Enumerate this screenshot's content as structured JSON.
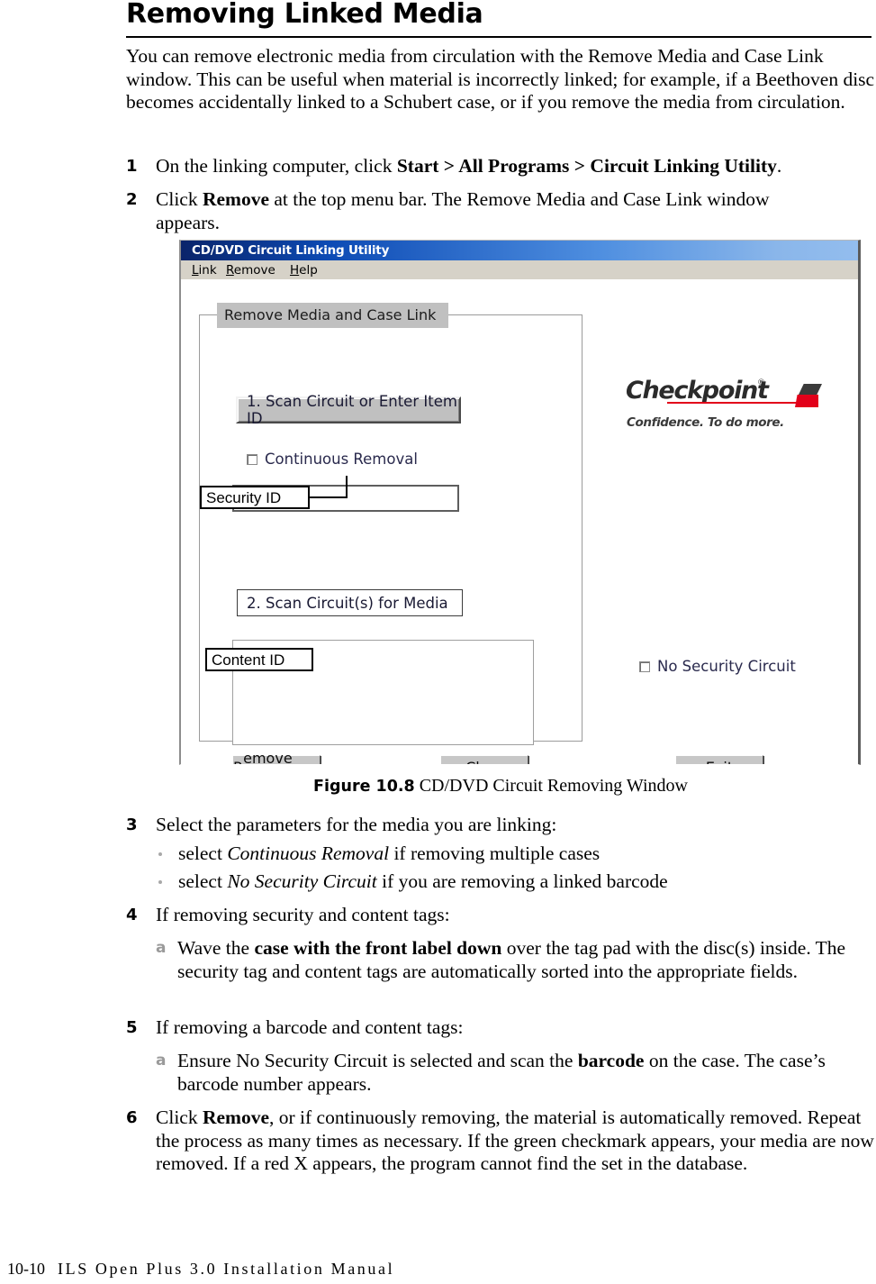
{
  "page": {
    "title": "Removing Linked Media",
    "intro": "You can remove electronic media from circulation with the Remove Media and Case Link window. This can be useful when material is incorrectly linked; for example, if a Beethoven disc becomes accidentally linked to a Schubert case, or if you remove the media from circulation."
  },
  "steps": {
    "s1": {
      "num": "1",
      "lead": "On the linking computer, click ",
      "bold": "Start > All Programs > Circuit Linking Utility",
      "tail": "."
    },
    "s2": {
      "num": "2",
      "lead": "Click ",
      "bold": "Remove",
      "tail": " at the top menu bar. The Remove Media and Case Link window appears."
    },
    "s3": {
      "num": "3",
      "text": "Select the parameters for the media you are linking:"
    },
    "b1": {
      "lead": "select ",
      "italic": "Continuous Removal",
      "tail": " if removing multiple cases"
    },
    "b2": {
      "lead": "select ",
      "italic": "No Security Circuit",
      "tail": " if you are removing a linked barcode"
    },
    "s4": {
      "num": "4",
      "text": "If removing security and content tags:"
    },
    "s4a": {
      "letter": "a",
      "lead": "Wave the ",
      "bold": "case with the front label down",
      "tail": " over the tag pad with the disc(s) inside. The security tag and content tags are automatically sorted into the appropriate fields."
    },
    "s5": {
      "num": "5",
      "text": "If removing a barcode and content tags:"
    },
    "s5a": {
      "letter": "a",
      "lead": "Ensure No Security Circuit is selected and scan the ",
      "bold": "barcode",
      "tail": " on the case. The case’s barcode number appears."
    },
    "s6": {
      "num": "6",
      "lead": "Click ",
      "bold": "Remove",
      "tail": ", or if continuously removing, the material is automatically removed. Repeat the process as many times as necessary. If the green checkmark appears, your media are now removed. If a red X appears, the program cannot find the set in the database."
    }
  },
  "figure": {
    "label": "Figure 10.8",
    "caption": " CD/DVD Circuit Removing Window"
  },
  "app": {
    "title": "CD/DVD Circuit Linking Utility",
    "menu": {
      "link": "Link",
      "link_mnemonic": "L",
      "link_rest": "ink",
      "remove": "Remove",
      "remove_mnemonic": "R",
      "remove_rest": "emove",
      "help": "Help",
      "help_mnemonic": "H",
      "help_rest": "elp"
    },
    "group_legend": "Remove Media and Case Link",
    "banner1": "1. Scan Circuit or Enter Item ID",
    "banner2": "2. Scan Circuit(s) for Media",
    "checkbox_continuous": "Continuous Removal",
    "checkbox_nosecurity": "No Security Circuit",
    "field_security_value": "",
    "field_content_value": "",
    "buttons": {
      "remove_link_mnemonic": "R",
      "remove_link_rest": "emove Link",
      "clear_mnemonic": "C",
      "clear_rest": "lear",
      "exit_pre": "E",
      "exit_mnemonic": "x",
      "exit_rest": "it"
    },
    "logo": {
      "word": "Checkpoint",
      "registered": "®",
      "tagline": "Confidence. To do more."
    },
    "colors": {
      "titlebar_dark": "#0a246a",
      "titlebar_light": "#93bdee",
      "menubar": "#d6d2c8",
      "button_face": "#c0c0c0",
      "logo_red": "#e2001a"
    }
  },
  "callouts": {
    "security_id": "Security ID",
    "content_id": "Content ID"
  },
  "footer": {
    "page_number": "10-10",
    "manual_title": "ILS Open Plus 3.0 Installation Manual"
  }
}
